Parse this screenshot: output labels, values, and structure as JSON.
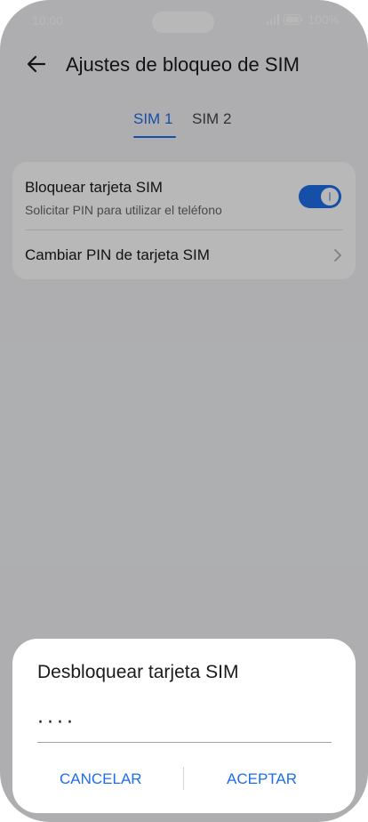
{
  "status_bar": {
    "time": "10:00",
    "battery": "100%",
    "icons": [
      "signal-icon",
      "battery-icon"
    ]
  },
  "header": {
    "title": "Ajustes de bloqueo de SIM",
    "back_icon": "back-arrow-icon"
  },
  "tabs": [
    {
      "label": "SIM 1",
      "active": true
    },
    {
      "label": "SIM 2",
      "active": false
    }
  ],
  "settings": {
    "lock_sim": {
      "title": "Bloquear tarjeta SIM",
      "subtitle": "Solicitar PIN para utilizar el teléfono",
      "enabled": true
    },
    "change_pin": {
      "title": "Cambiar PIN de tarjeta SIM",
      "icon": "chevron-right-icon"
    }
  },
  "dialog": {
    "title": "Desbloquear tarjeta SIM",
    "pin_value": "····",
    "cancel_label": "CANCELAR",
    "accept_label": "ACEPTAR"
  },
  "colors": {
    "accent": "#1e6ee8",
    "background": "#f1f2f4",
    "card": "#ffffff"
  }
}
